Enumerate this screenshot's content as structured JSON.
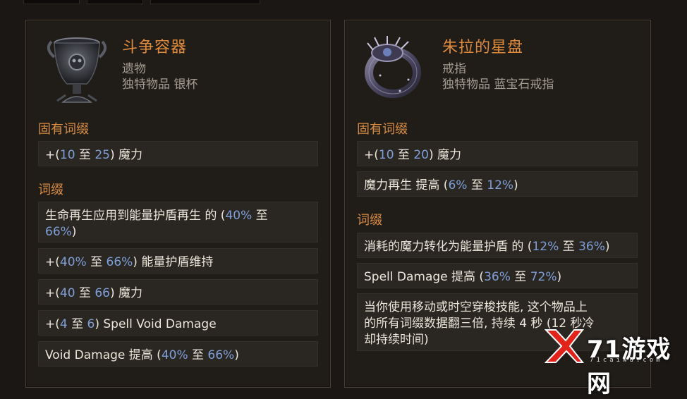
{
  "colors": {
    "title": "#e08a3c",
    "section": "#d98c42",
    "number": "#7f9fd8",
    "text": "#ece6da",
    "subtext": "#a49c90"
  },
  "left": {
    "icon": "silver-cup-icon",
    "name": "斗争容器",
    "type": "遗物",
    "subtype": "独特物品 银杯",
    "implicit_heading": "固有词缀",
    "implicit": [
      {
        "pre": "+(",
        "a": "10",
        "mid": " 至 ",
        "b": "25",
        "post": ") 魔力"
      }
    ],
    "mods_heading": "词缀",
    "mods": [
      {
        "text1": "生命再生应用到能量护盾再生 的 (",
        "a": "40%",
        "mid": " 至 ",
        "b": "66%",
        "post": ")"
      },
      {
        "pre": "+(",
        "a": "40%",
        "mid": " 至 ",
        "b": "66%",
        "post": ") 能量护盾维持"
      },
      {
        "pre": "+(",
        "a": "40",
        "mid": " 至 ",
        "b": "66",
        "post": ") 魔力"
      },
      {
        "pre": "+(",
        "a": "4",
        "mid": " 至 ",
        "b": "6",
        "post": ") Spell Void Damage"
      },
      {
        "pre": "Void Damage 提高 (",
        "a": "40%",
        "mid": " 至 ",
        "b": "66%",
        "post": ")"
      }
    ]
  },
  "right": {
    "icon": "ring-icon",
    "name": "朱拉的星盘",
    "type": "戒指",
    "subtype": "独特物品 蓝宝石戒指",
    "implicit_heading": "固有词缀",
    "implicit": [
      {
        "pre": "+(",
        "a": "10",
        "mid": " 至 ",
        "b": "20",
        "post": ") 魔力"
      },
      {
        "pre": "魔力再生 提高 (",
        "a": "6%",
        "mid": " 至 ",
        "b": "12%",
        "post": ")"
      }
    ],
    "mods_heading": "词缀",
    "mods": [
      {
        "pre": "消耗的魔力转化为能量护盾 的 (",
        "a": "12%",
        "mid": " 至 ",
        "b": "36%",
        "post": ")"
      },
      {
        "pre": "Spell Damage 提高 (",
        "a": "36%",
        "mid": " 至 ",
        "b": "72%",
        "post": ")"
      },
      {
        "line1": "当你使用移动或时空穿梭技能, 这个物品上",
        "line2": "的所有词缀数据翻三倍, 持续 4 秒 (12 秒冷",
        "line3": "却持续时间)"
      }
    ]
  },
  "watermark": {
    "text": "71游戏网",
    "sub": "71caiwu.com"
  }
}
